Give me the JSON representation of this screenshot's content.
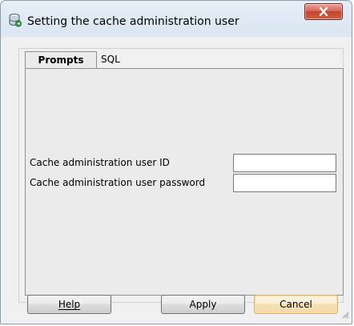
{
  "window": {
    "title": "Setting the cache administration user",
    "icon": "database-wizard-icon",
    "close_icon": "close-icon"
  },
  "tabs": [
    {
      "label": "Prompts",
      "active": true
    },
    {
      "label": "SQL",
      "active": false
    }
  ],
  "form": {
    "user_id_label": "Cache administration user ID",
    "user_id_value": "",
    "password_label": "Cache administration user password",
    "password_value": ""
  },
  "buttons": {
    "help": "Help",
    "apply": "Apply",
    "cancel": "Cancel"
  },
  "colors": {
    "close_button": "#c34432",
    "default_button_border": "#dfb26c",
    "panel_bg": "#ebebeb"
  }
}
